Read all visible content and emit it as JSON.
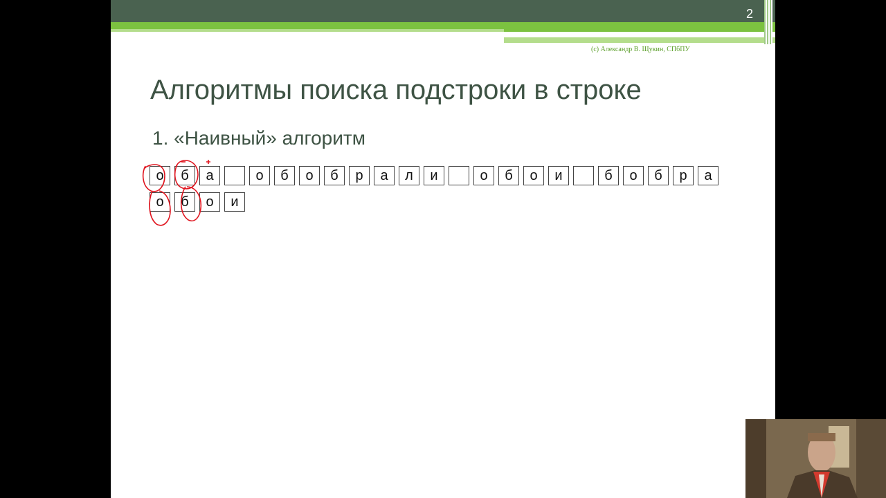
{
  "slide": {
    "page_number": "2",
    "copyright": "(c) Александр В. Щукин, СПбПУ",
    "title": "Алгоритмы поиска подстроки в строке",
    "subtitle": "1. «Наивный» алгоритм",
    "text_cells": [
      "о",
      "б",
      "а",
      " ",
      "о",
      "б",
      "о",
      "б",
      "р",
      "а",
      "л",
      "и",
      " ",
      "о",
      "б",
      "о",
      "и",
      " ",
      "б",
      "о",
      "б",
      "р",
      "а"
    ],
    "pattern_cells": [
      "о",
      "б",
      "о",
      "и"
    ],
    "annotation_color": "#e0141e"
  },
  "theme": {
    "header_dark": "#4a6250",
    "accent_green": "#7cc240",
    "light_green": "#b4dd8c",
    "title_color": "#3e5344"
  }
}
